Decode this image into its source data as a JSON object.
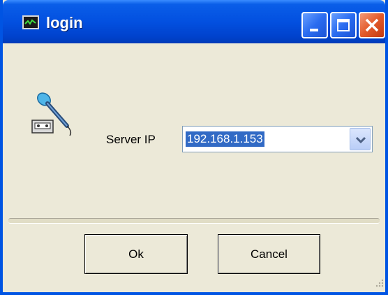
{
  "window": {
    "title": "login",
    "icon": "app-monitor-icon",
    "controls": [
      "minimize-icon",
      "maximize-icon",
      "close-icon"
    ],
    "colors": {
      "titlebar": "#0054e3",
      "body": "#ece9d8",
      "selection": "#316ac5"
    }
  },
  "form": {
    "server_label": "Server IP",
    "server_value": "192.168.1.153"
  },
  "buttons": {
    "ok": "Ok",
    "cancel": "Cancel"
  },
  "icons": {
    "decor": "microphone-cassette-icon"
  }
}
